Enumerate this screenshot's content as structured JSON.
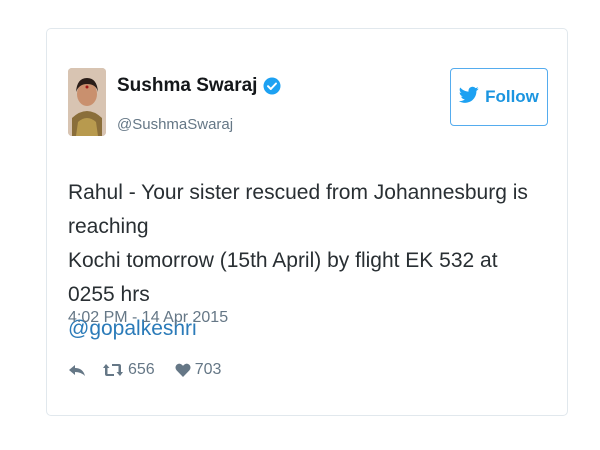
{
  "tweet": {
    "author_name": "Sushma Swaraj",
    "handle": "@SushmaSwaraj",
    "follow_label": "Follow",
    "text_line1": "Rahul - Your sister rescued from Johannesburg is reaching",
    "text_line2": "Kochi tomorrow (15th April) by flight EK 532 at 0255 hrs",
    "mention": "@gopalkeshri",
    "timestamp": "4:02 PM - 14 Apr 2015",
    "retweet_count": "656",
    "like_count": "703"
  },
  "icons": {
    "verified": "verified-badge-icon",
    "follow": "twitter-bird-icon",
    "reply": "reply-icon",
    "retweet": "retweet-icon",
    "like": "heart-icon"
  },
  "colors": {
    "accent": "#1b95e0",
    "text": "#292f33",
    "muted": "#657786",
    "link": "#2b7bb9",
    "border": "#e1e8ed"
  }
}
